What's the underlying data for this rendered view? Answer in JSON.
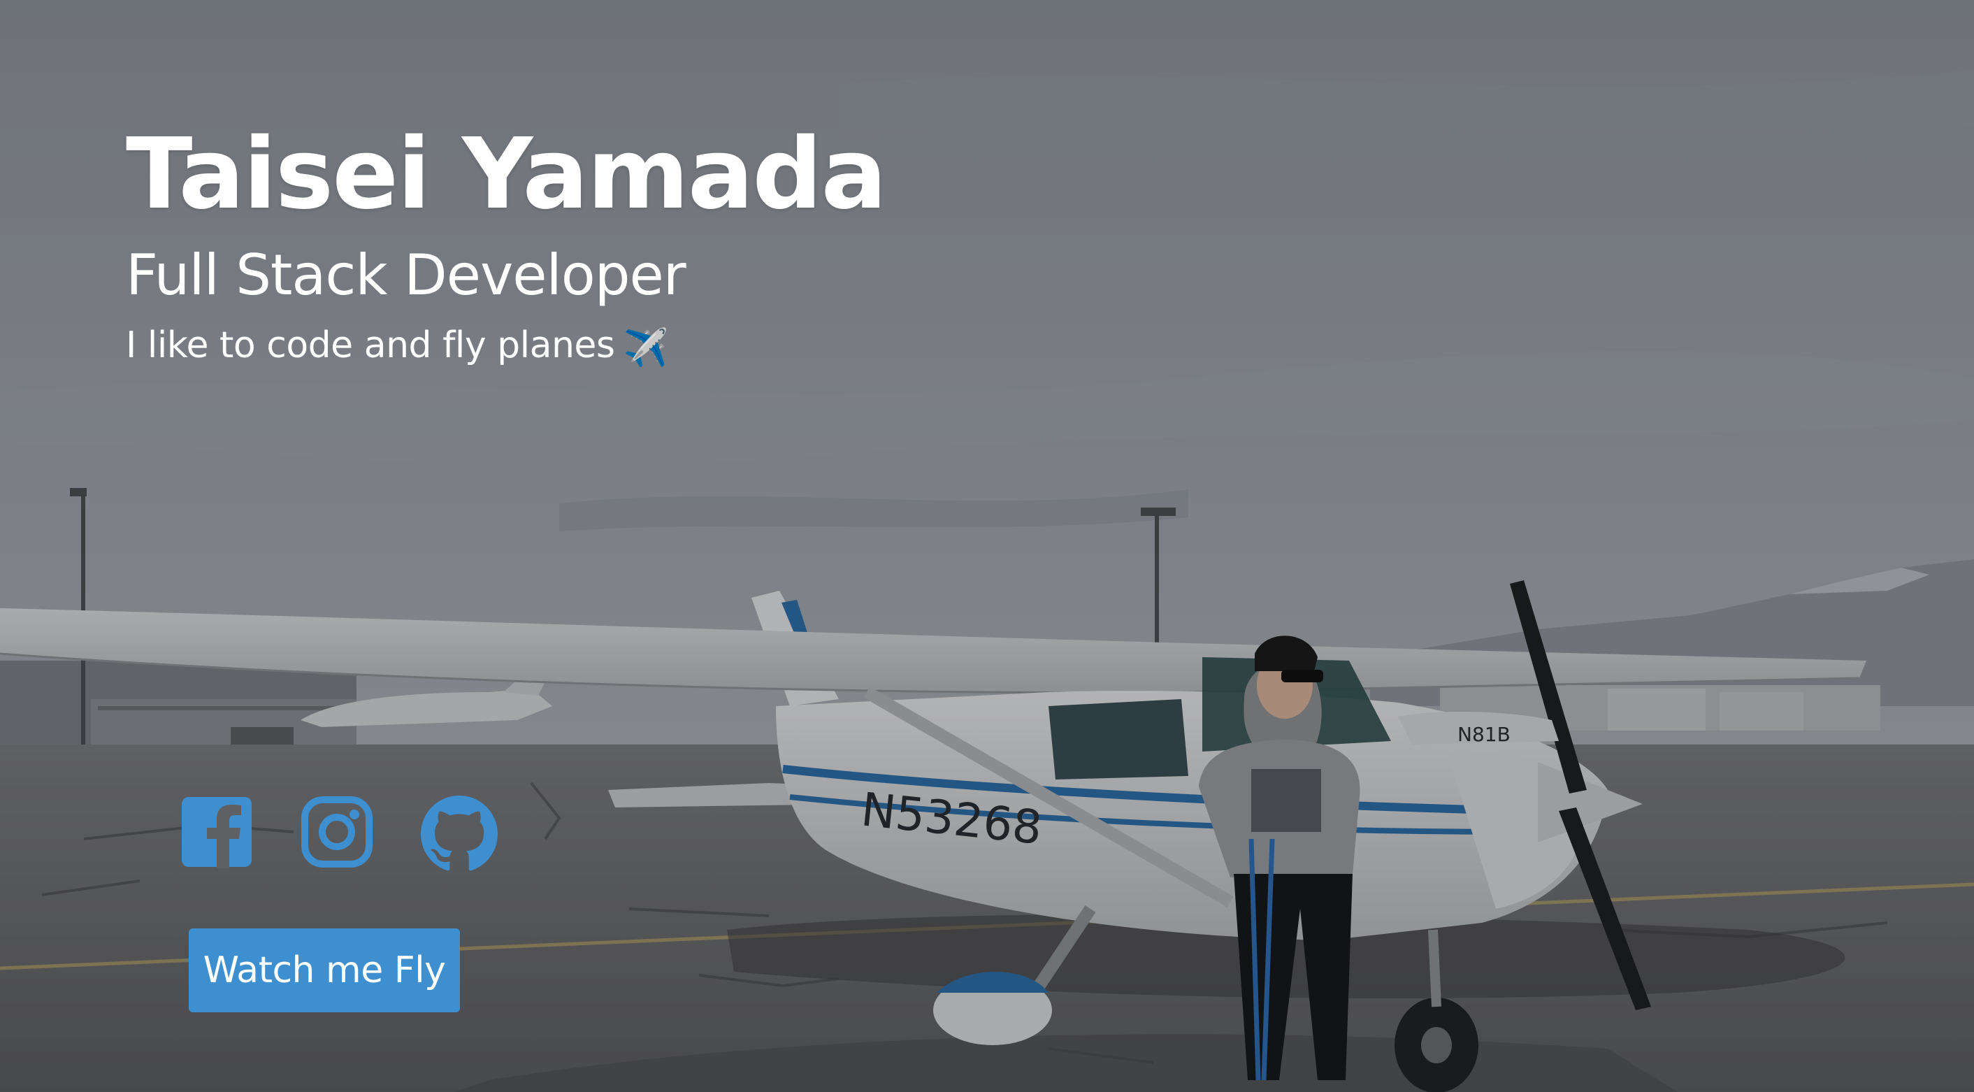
{
  "hero": {
    "name": "Taisei Yamada",
    "role": "Full Stack Developer",
    "tagline": "I like to code and fly planes",
    "tagline_emoji": "✈️"
  },
  "social": [
    {
      "icon": "facebook-icon"
    },
    {
      "icon": "instagram-icon"
    },
    {
      "icon": "github-icon"
    }
  ],
  "cta": {
    "label": "Watch me Fly"
  },
  "photo": {
    "aircraft_registration": "N53268",
    "background_aircraft_registration": "N81B"
  },
  "colors": {
    "accent": "#3d8fd0",
    "text": "#ffffff",
    "sky": "#8a909a",
    "tarmac": "#5e6065"
  }
}
